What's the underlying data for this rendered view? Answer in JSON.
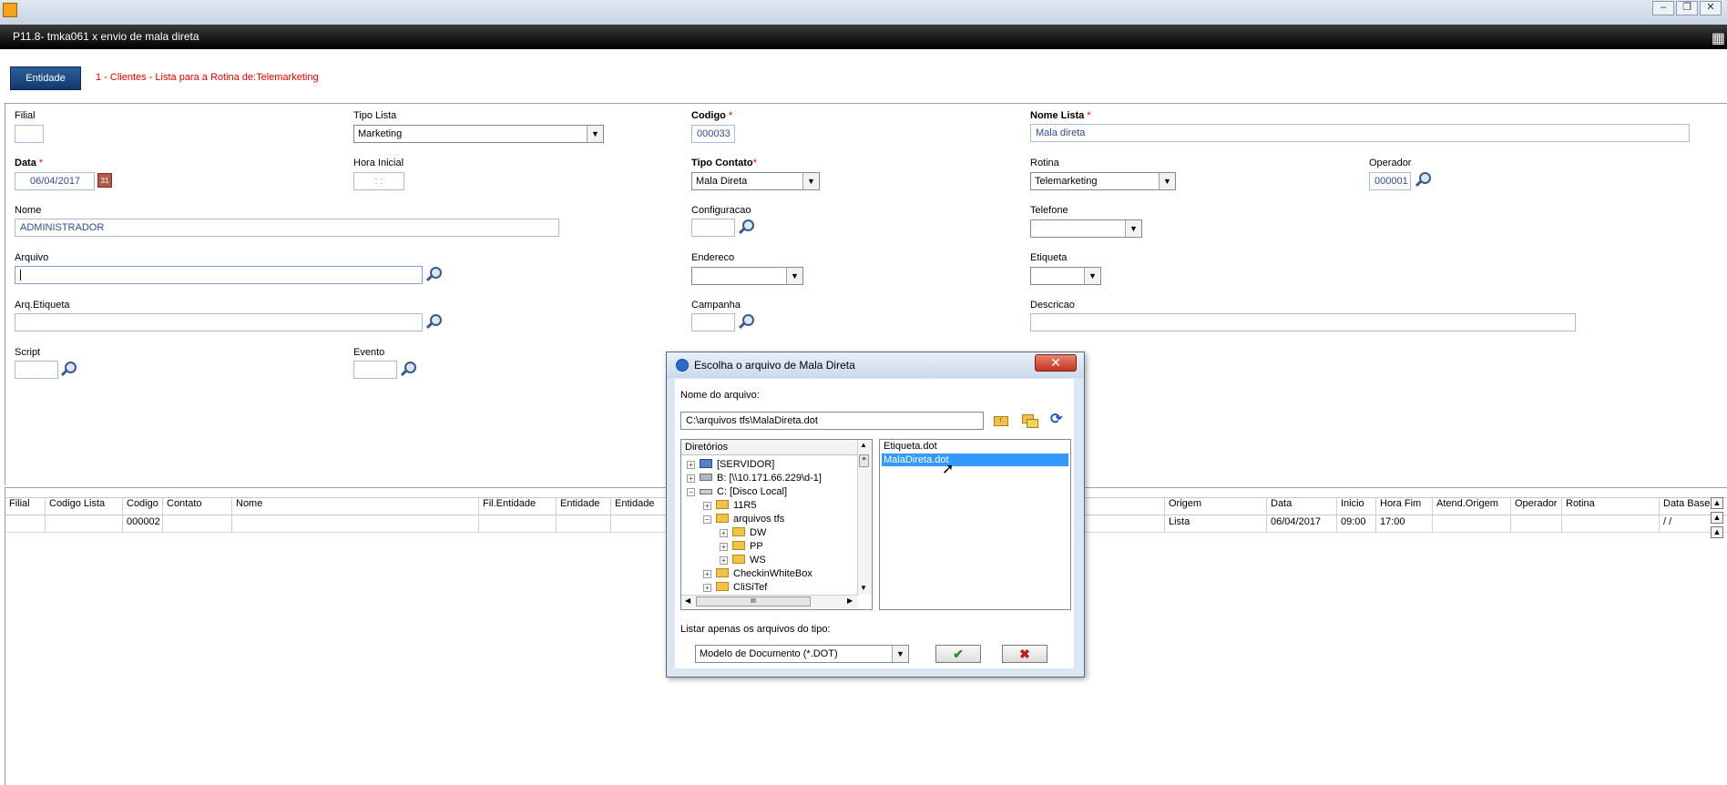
{
  "window": {
    "title": "P11.8- tmka061 x envio de mala direta",
    "minimize_glyph": "‒",
    "restore_glyph": "❐",
    "close_glyph": "✕",
    "grid_icon_glyph": "▦"
  },
  "entity_bar": {
    "button_label": "Entidade",
    "text": "1 - Clientes - Lista para a Rotina de:Telemarketing",
    "accent": "#e00000"
  },
  "form": {
    "filial_label": "Filial",
    "filial_value": "",
    "tipo_lista_label": "Tipo Lista",
    "tipo_lista_value": "Marketing",
    "codigo_label": "Codigo",
    "codigo_value": "000033",
    "nome_lista_label": "Nome Lista",
    "nome_lista_value": "Mala direta",
    "data_label": "Data",
    "data_value": "06/04/2017",
    "hora_inicial_label": "Hora Inicial",
    "hora_inicial_value": ": :",
    "tipo_contato_label": "Tipo Contato",
    "tipo_contato_value": "Mala Direta",
    "rotina_label": "Rotina",
    "rotina_value": "Telemarketing",
    "operador_label": "Operador",
    "operador_value": "000001",
    "nome_label": "Nome",
    "nome_value": "ADMINISTRADOR",
    "configuracao_label": "Configuracao",
    "telefone_label": "Telefone",
    "arquivo_label": "Arquivo",
    "endereco_label": "Endereco",
    "etiqueta_label": "Etiqueta",
    "arq_etiqueta_label": "Arq.Etiqueta",
    "campanha_label": "Campanha",
    "descricao_label": "Descricao",
    "script_label": "Script",
    "evento_label": "Evento",
    "required_mark": "*"
  },
  "grid": {
    "headers": [
      "Filial",
      "Codigo Lista",
      "Codigo",
      "Contato",
      "Nome",
      "Fil.Entidade",
      "Entidade",
      "Entidade",
      "Origem",
      "Data",
      "Inicio",
      "Hora Fim",
      "Atend.Origem",
      "Operador",
      "Rotina",
      "Data Base"
    ],
    "row": [
      "",
      "",
      "000002",
      "",
      "",
      "",
      "",
      "",
      "Lista",
      "06/04/2017",
      "09:00",
      "17:00",
      "",
      "",
      "",
      "/ /"
    ]
  },
  "dialog": {
    "title": "Escolha o arquivo de Mala Direta",
    "close_glyph": "✕",
    "filename_label": "Nome do arquivo:",
    "filename_value": "C:\\arquivos tfs\\MalaDireta.dot",
    "dirs_header": "Diretórios",
    "tree": [
      "[SERVIDOR]",
      "B: [\\\\10.171.66.229\\d-1]",
      "C: [Disco Local]",
      "11R5",
      "arquivos tfs",
      "DW",
      "PP",
      "WS",
      "CheckinWhiteBox",
      "CliSiTef"
    ],
    "files": [
      "Etiqueta.dot",
      "MalaDireta.dot"
    ],
    "filetype_label": "Listar apenas os arquivos do tipo:",
    "filetype_value": "Modelo de Documento (*.DOT)",
    "ok_glyph": "✔",
    "cancel_glyph": "✖",
    "hscroll_thumb": "III",
    "selection_color": "#3399ff"
  }
}
